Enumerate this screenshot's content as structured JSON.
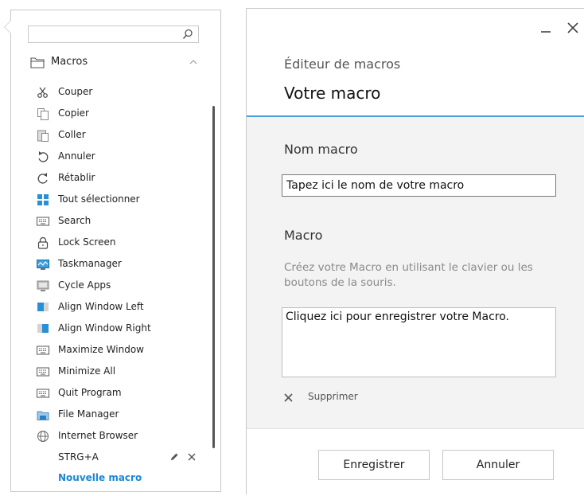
{
  "sidebar": {
    "search": {
      "value": "",
      "placeholder": ""
    },
    "group_label": "Macros",
    "items": [
      {
        "label": "Couper",
        "icon": "scissors-icon"
      },
      {
        "label": "Copier",
        "icon": "copy-icon"
      },
      {
        "label": "Coller",
        "icon": "paste-icon"
      },
      {
        "label": "Annuler",
        "icon": "undo-icon"
      },
      {
        "label": "Rétablir",
        "icon": "redo-icon"
      },
      {
        "label": "Tout sélectionner",
        "icon": "select-all-icon"
      },
      {
        "label": "Search",
        "icon": "keyboard-icon"
      },
      {
        "label": "Lock Screen",
        "icon": "lock-icon"
      },
      {
        "label": "Taskmanager",
        "icon": "taskmanager-icon"
      },
      {
        "label": "Cycle Apps",
        "icon": "cycle-apps-icon"
      },
      {
        "label": "Align Window Left",
        "icon": "window-left-icon"
      },
      {
        "label": "Align Window Right",
        "icon": "window-right-icon"
      },
      {
        "label": "Maximize Window",
        "icon": "keyboard-icon"
      },
      {
        "label": "Minimize All",
        "icon": "keyboard-icon"
      },
      {
        "label": "Quit Program",
        "icon": "keyboard-icon"
      },
      {
        "label": "File Manager",
        "icon": "file-manager-icon"
      },
      {
        "label": "Internet Browser",
        "icon": "globe-icon"
      },
      {
        "label": "STRG+A",
        "icon": ""
      }
    ],
    "new_macro_label": "Nouvelle macro"
  },
  "editor": {
    "subtitle": "Éditeur de macros",
    "title": "Votre macro",
    "name_label": "Nom macro",
    "name_value": "Tapez ici le nom de votre macro",
    "macro_label": "Macro",
    "macro_hint": "Créez votre Macro en utilisant le clavier ou les boutons de la souris.",
    "record_text": "Cliquez ici pour enregistrer votre Macro.",
    "delete_label": "Supprimer",
    "save_label": "Enregistrer",
    "cancel_label": "Annuler"
  },
  "colors": {
    "accent": "#4a9fd8",
    "link": "#1a88d6",
    "body_bg": "#f3f3f3"
  }
}
